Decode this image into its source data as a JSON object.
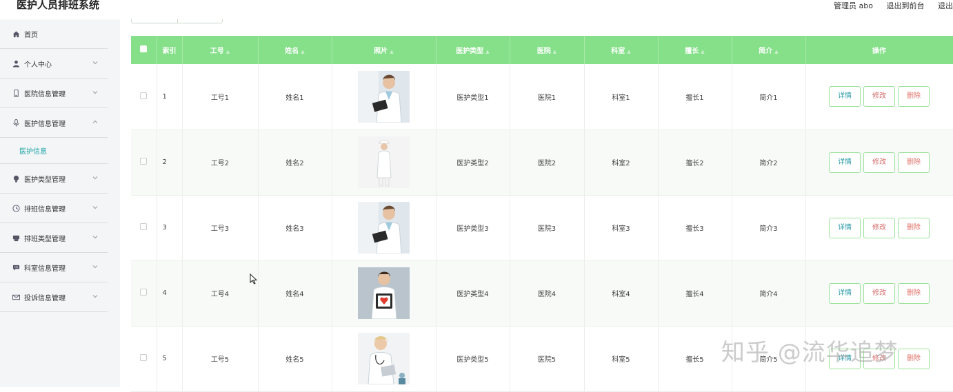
{
  "app": {
    "title": "医护人员排班系统"
  },
  "topbar": {
    "admin": "管理员 abo",
    "front": "退出到前台",
    "logout": "退出"
  },
  "sidebar": {
    "items": [
      {
        "label": "首页",
        "icon": "home-icon"
      },
      {
        "label": "个人中心",
        "icon": "user-icon"
      },
      {
        "label": "医院信息管理",
        "icon": "phone-icon"
      },
      {
        "label": "医护信息管理",
        "icon": "mic-icon"
      },
      {
        "label": "医护类型管理",
        "icon": "bulb-icon"
      },
      {
        "label": "排班信息管理",
        "icon": "clock-icon"
      },
      {
        "label": "排班类型管理",
        "icon": "printer-icon"
      },
      {
        "label": "科室信息管理",
        "icon": "chat-icon"
      },
      {
        "label": "投诉信息管理",
        "icon": "mail-icon"
      }
    ],
    "sub_item": "医护信息"
  },
  "table": {
    "headers": [
      "索引",
      "工号",
      "姓名",
      "照片",
      "医护类型",
      "医院",
      "科室",
      "擅长",
      "简介",
      "操作"
    ],
    "rows": [
      {
        "index": "1",
        "gonghao": "工号1",
        "name": "姓名1",
        "type": "医护类型1",
        "hospital": "医院1",
        "dept": "科室1",
        "skill": "擅长1",
        "intro": "简介1"
      },
      {
        "index": "2",
        "gonghao": "工号2",
        "name": "姓名2",
        "type": "医护类型2",
        "hospital": "医院2",
        "dept": "科室2",
        "skill": "擅长2",
        "intro": "简介2"
      },
      {
        "index": "3",
        "gonghao": "工号3",
        "name": "姓名3",
        "type": "医护类型3",
        "hospital": "医院3",
        "dept": "科室3",
        "skill": "擅长3",
        "intro": "简介3"
      },
      {
        "index": "4",
        "gonghao": "工号4",
        "name": "姓名4",
        "type": "医护类型4",
        "hospital": "医院4",
        "dept": "科室4",
        "skill": "擅长4",
        "intro": "简介4"
      },
      {
        "index": "5",
        "gonghao": "工号5",
        "name": "姓名5",
        "type": "医护类型5",
        "hospital": "医院5",
        "dept": "科室5",
        "skill": "擅长5",
        "intro": "简介5"
      }
    ],
    "actions": {
      "detail": "详情",
      "edit": "修改",
      "delete": "删除"
    }
  },
  "watermark": "知乎 @流华追梦",
  "colors": {
    "header_bg": "#86e08a",
    "accent": "#1aa3a3",
    "sidebar_bg": "#f3f5f7"
  }
}
